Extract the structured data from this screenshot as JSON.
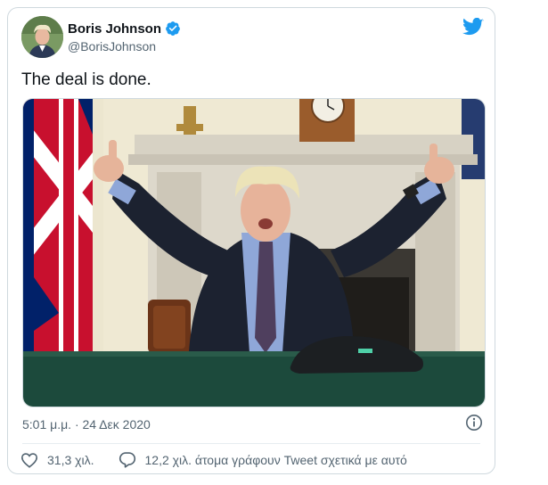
{
  "user": {
    "name": "Boris Johnson",
    "handle": "@BorisJohnson",
    "verified": true
  },
  "tweet": {
    "text": "The deal is done.",
    "timestamp": "5:01 μ.μ. · 24 Δεκ 2020"
  },
  "actions": {
    "likes": "31,3 χιλ.",
    "conversation": "12,2 χιλ. άτομα γράφουν Tweet σχετικά με αυτό"
  },
  "icons": {
    "brand": "twitter-bird-icon",
    "verified": "verified-badge-icon",
    "info": "info-icon",
    "like": "heart-icon",
    "reply": "speech-bubble-icon"
  },
  "colors": {
    "brand": "#1d9bf0",
    "text": "#0f1419",
    "secondary": "#536471",
    "border": "#cfd9de"
  }
}
